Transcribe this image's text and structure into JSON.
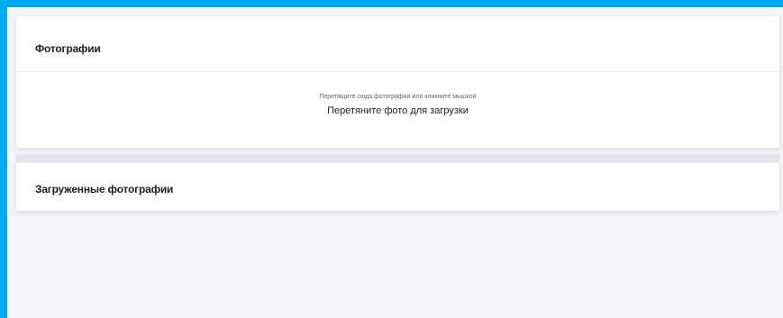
{
  "photos_section": {
    "title": "Фотографии",
    "drop_hint": "Перетащите сюда фотографии или кликните мышкой",
    "drop_main": "Перетяните фото для загрузки"
  },
  "uploaded_section": {
    "title": "Загруженные фотографии"
  },
  "colors": {
    "frame_border": "#00aaee",
    "background": "#f2f3f7",
    "card": "#ffffff"
  }
}
